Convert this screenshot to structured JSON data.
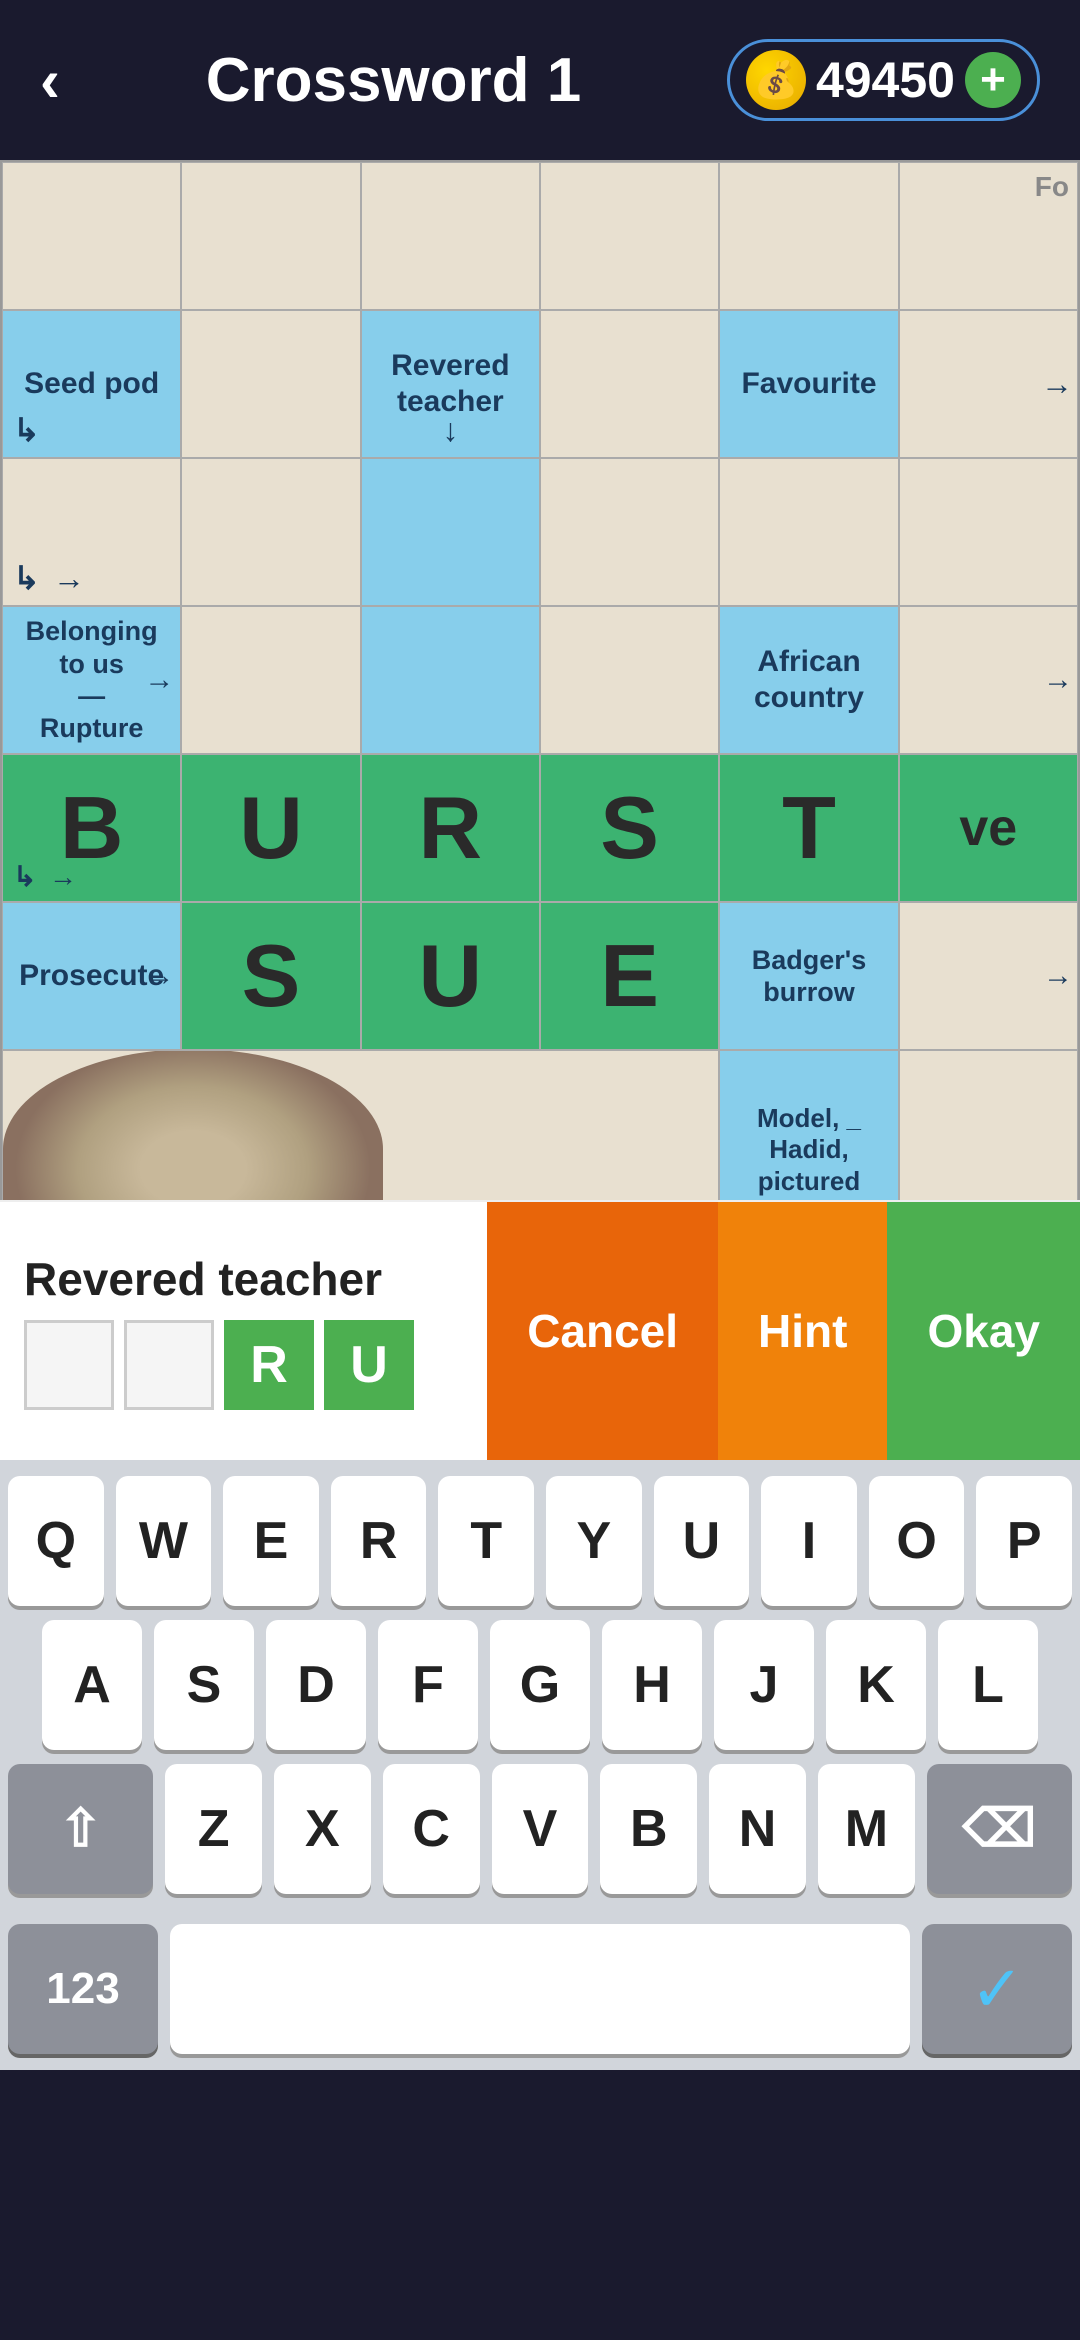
{
  "header": {
    "back_label": "‹",
    "title": "Crossword 1",
    "coin_icon": "💰",
    "coin_amount": "49450",
    "add_label": "+"
  },
  "grid": {
    "rows": 7,
    "cols": 6
  },
  "clue_bar": {
    "clue_text": "Revered teacher",
    "answer_boxes": [
      "",
      "",
      "R",
      "U"
    ],
    "cancel_label": "Cancel",
    "hint_label": "Hint",
    "okay_label": "Okay"
  },
  "clues": {
    "seed_pod": "Seed pod",
    "revered_teacher": "Revered teacher",
    "favourite": "Favourite",
    "belonging_rupture": "Belonging to us\n—\nRupture",
    "african_country": "African country",
    "prosecute": "Prosecute",
    "badgers_burrow": "Badger's burrow",
    "model_hadid": "Model, _\nHadid,\npictured"
  },
  "letters": {
    "B": "B",
    "U": "U",
    "R": "R",
    "S": "S",
    "T": "T",
    "S2": "S",
    "U2": "U",
    "E": "E",
    "ve": "ve"
  },
  "keyboard": {
    "row1": [
      "Q",
      "W",
      "E",
      "R",
      "T",
      "Y",
      "U",
      "I",
      "O",
      "P"
    ],
    "row2": [
      "A",
      "S",
      "D",
      "F",
      "G",
      "H",
      "J",
      "K",
      "L"
    ],
    "row3_special_left": "⇧",
    "row3": [
      "Z",
      "X",
      "C",
      "V",
      "B",
      "N",
      "M"
    ],
    "row3_special_right": "⌫",
    "bottom_left": "123",
    "bottom_right_check": "✓"
  },
  "colors": {
    "beige": "#e8e0d0",
    "light_blue": "#87ceeb",
    "green": "#3cb371",
    "dark_header": "#1a1a2e",
    "orange_cancel": "#e8650a",
    "orange_hint": "#f0820a",
    "green_okay": "#4caf50",
    "keyboard_bg": "#d1d5db",
    "key_bg": "#ffffff",
    "key_dark": "#8d9099"
  }
}
